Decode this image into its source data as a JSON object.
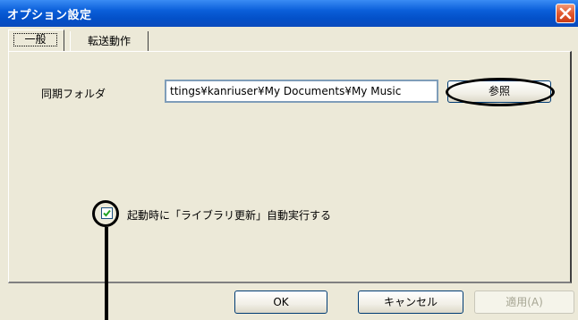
{
  "window": {
    "title": "オプション設定"
  },
  "tabs": [
    {
      "label": "一般"
    },
    {
      "label": "転送動作"
    }
  ],
  "general": {
    "sync_folder_label": "同期フォルダ",
    "sync_folder_value": "ttings¥kanriuser¥My Documents¥My Music",
    "browse_label": "参照",
    "auto_update_label": "起動時に「ライブラリ更新」自動実行する",
    "auto_update_checked": true
  },
  "buttons": {
    "ok": "OK",
    "cancel": "キャンセル",
    "apply": "適用(A)"
  },
  "colors": {
    "titlebar": "#0a5ed9",
    "dialog_bg": "#ece9d8",
    "close": "#e2582e",
    "callout": "#000000"
  },
  "icons": [
    "close-icon",
    "checkmark-icon"
  ]
}
